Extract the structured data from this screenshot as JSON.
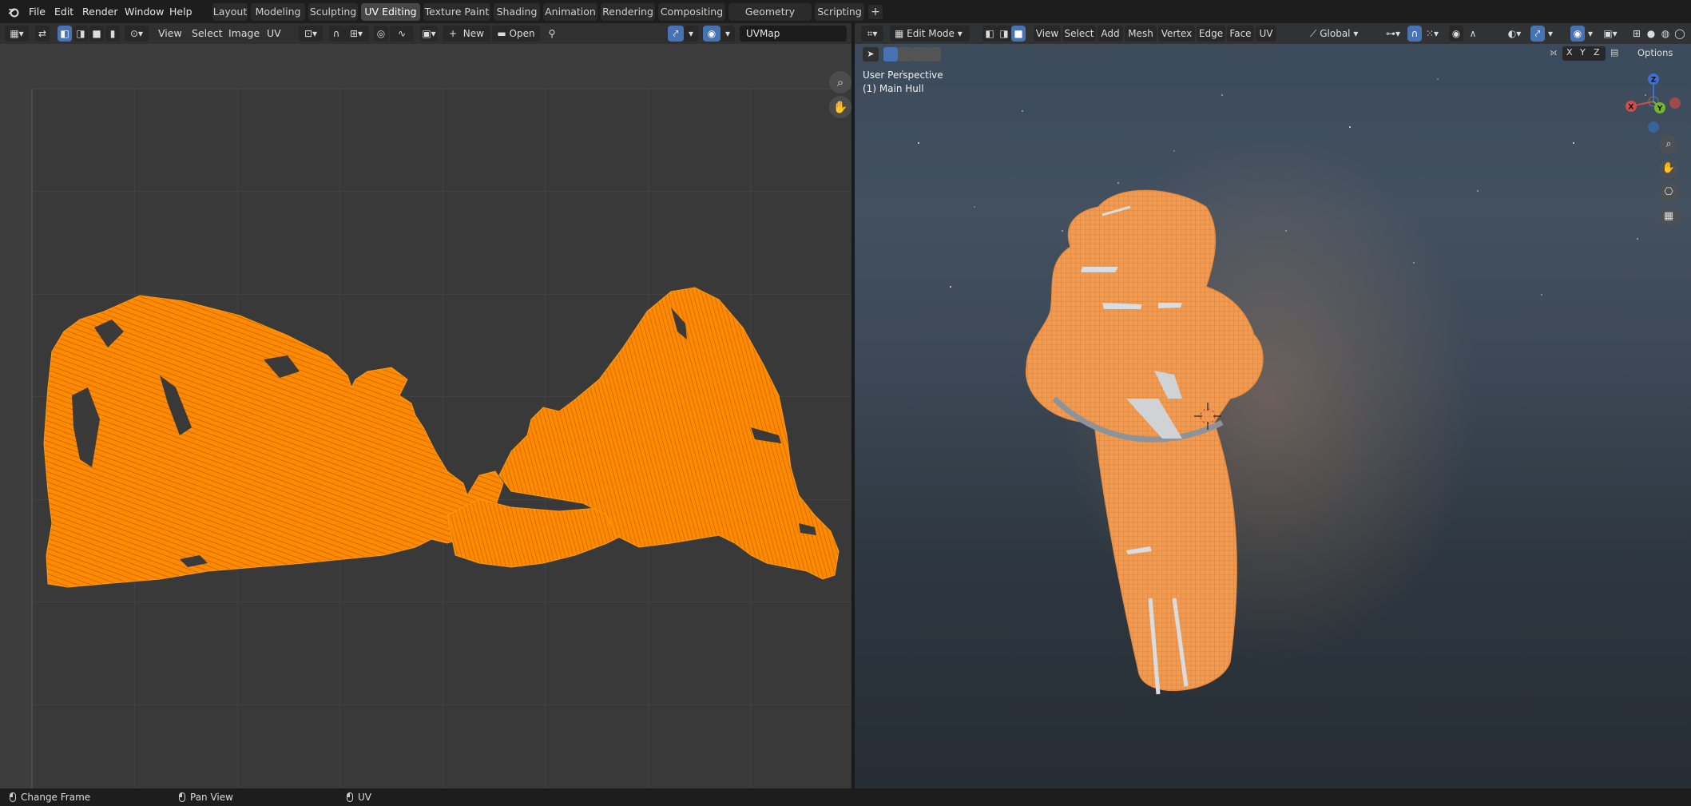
{
  "menu": {
    "file": "File",
    "edit": "Edit",
    "render": "Render",
    "window": "Window",
    "help": "Help"
  },
  "workspaces": [
    {
      "label": "Layout"
    },
    {
      "label": "Modeling"
    },
    {
      "label": "Sculpting"
    },
    {
      "label": "UV Editing",
      "active": true
    },
    {
      "label": "Texture Paint"
    },
    {
      "label": "Shading"
    },
    {
      "label": "Animation"
    },
    {
      "label": "Rendering"
    },
    {
      "label": "Compositing"
    },
    {
      "label": "Geometry Nodes"
    },
    {
      "label": "Scripting"
    }
  ],
  "add_workspace": "+",
  "uv_editor": {
    "menus": [
      "View",
      "Select",
      "Image",
      "UV"
    ],
    "new_label": "New",
    "open_label": "Open",
    "uvmap_value": "UVMap"
  },
  "viewport": {
    "mode": "Edit Mode",
    "menus": [
      "View",
      "Select",
      "Add",
      "Mesh",
      "Vertex",
      "Edge",
      "Face",
      "UV"
    ],
    "transform_orientation": "Global",
    "axis_x": "X",
    "axis_y": "Y",
    "axis_z": "Z",
    "options_label": "Options",
    "perspective_label": "User Perspective",
    "object_label": "(1) Main Hull"
  },
  "status": {
    "left_action": "Change Frame",
    "middle_action": "Pan View",
    "right_action": "UV"
  },
  "colors": {
    "accent": "#4772b3",
    "uv_mesh": "#ff8a00",
    "active_tab": "#474747"
  }
}
